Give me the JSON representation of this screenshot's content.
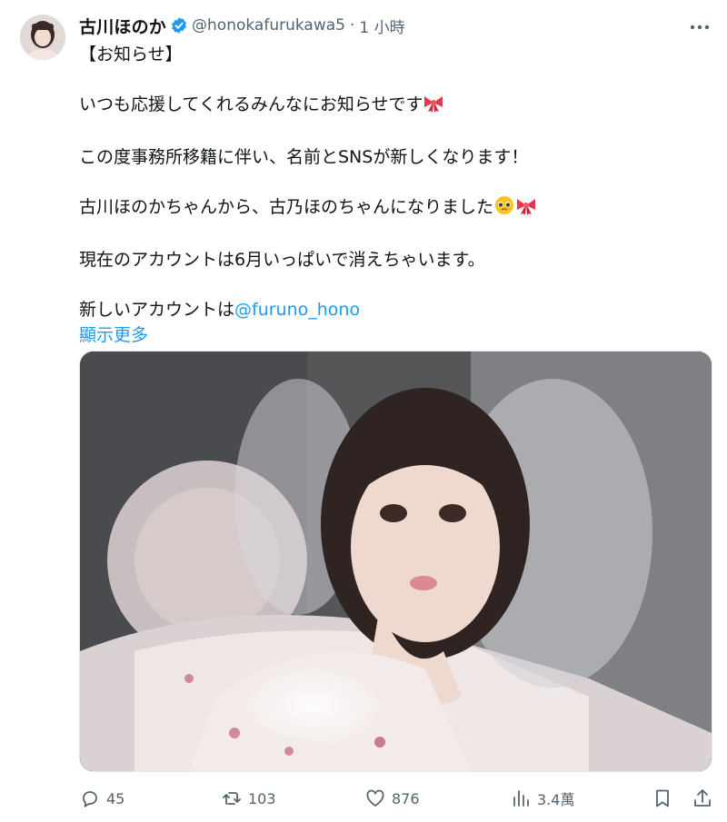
{
  "author": {
    "display_name": "古川ほのか",
    "handle": "@honokafurukawa5",
    "separator": "·",
    "time": "1 小時"
  },
  "tweet": {
    "line1": "【お知らせ】",
    "line2": "いつも応援してくれるみんなにお知らせです",
    "line3": "この度事務所移籍に伴い、名前とSNSが新しくなります！",
    "line4": "古川ほのかちゃんから、古乃ほのちゃんになりました",
    "line5": "現在のアカウントは6月いっぱいで消えちゃいます。",
    "line6_prefix": "新しいアカウントは",
    "mention": "@furuno_hono",
    "show_more": "顯示更多"
  },
  "metrics": {
    "replies": "45",
    "reposts": "103",
    "likes": "876",
    "views": "3.4萬"
  },
  "icons": {
    "more": "more-horizontal-icon",
    "verified": "verified-badge-icon",
    "reply": "reply-icon",
    "repost": "repost-icon",
    "like": "heart-icon",
    "views": "bar-chart-icon",
    "bookmark": "bookmark-icon",
    "share": "share-icon",
    "emoji_ribbon": "ribbon-emoji",
    "emoji_pleading": "pleading-face-emoji"
  },
  "colors": {
    "accent": "#1d9bf0",
    "secondary_text": "#536471",
    "text": "#0f1419"
  }
}
